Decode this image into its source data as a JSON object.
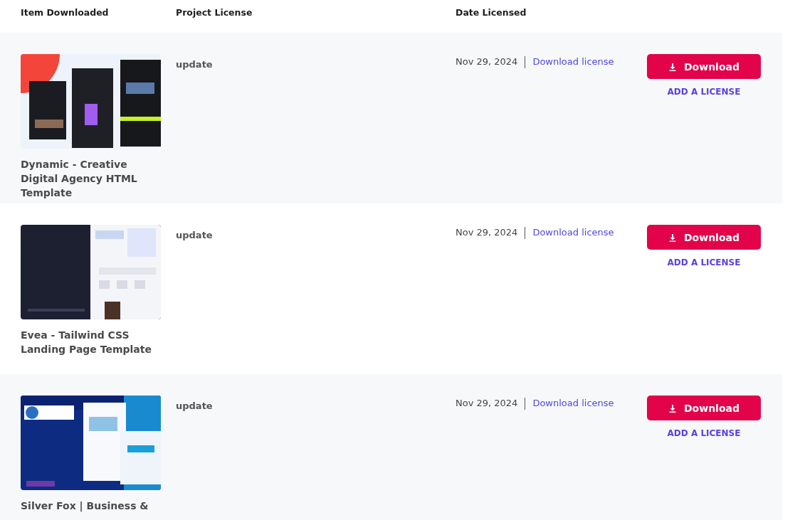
{
  "table": {
    "columns": [
      "Item Downloaded",
      "Project License",
      "Date Licensed"
    ],
    "rows": [
      {
        "title": "Dynamic - Creative Digital Agency HTML Template",
        "license": "update",
        "date": "Nov 29, 2024",
        "license_link": "Download license",
        "download_button": "Download",
        "add_license": "ADD A LICENSE"
      },
      {
        "title": "Evea - Tailwind CSS Landing Page Template",
        "license": "update",
        "date": "Nov 29, 2024",
        "license_link": "Download license",
        "download_button": "Download",
        "add_license": "ADD A LICENSE"
      },
      {
        "title": "Silver Fox | Business &",
        "license": "update",
        "date": "Nov 29, 2024",
        "license_link": "Download license",
        "download_button": "Download",
        "add_license": "ADD A LICENSE"
      }
    ]
  }
}
